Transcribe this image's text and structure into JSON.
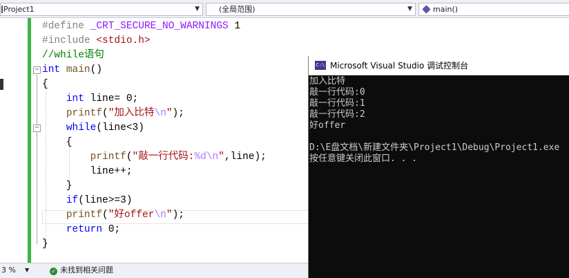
{
  "navbar": {
    "project": "Project1",
    "scope": "(全局范围)",
    "member": "main()"
  },
  "editor": {
    "lines": [
      {
        "parts": [
          [
            "pp",
            "#define "
          ],
          [
            "mac",
            "_CRT_SECURE_NO_WARNINGS"
          ],
          [
            "",
            " 1"
          ]
        ]
      },
      {
        "parts": [
          [
            "pp",
            "#include "
          ],
          [
            "str",
            "<stdio.h>"
          ]
        ]
      },
      {
        "parts": [
          [
            "cm",
            "//while语句"
          ]
        ]
      },
      {
        "parts": [
          [
            "k",
            "int"
          ],
          [
            "",
            " "
          ],
          [
            "fn",
            "main"
          ],
          [
            "",
            "()"
          ]
        ]
      },
      {
        "parts": [
          [
            "",
            "{"
          ]
        ]
      },
      {
        "parts": [
          [
            "",
            "    "
          ],
          [
            "k",
            "int"
          ],
          [
            "",
            " line= 0;"
          ]
        ]
      },
      {
        "parts": [
          [
            "",
            "    "
          ],
          [
            "fn",
            "printf"
          ],
          [
            "",
            "("
          ],
          [
            "str",
            "\"加入比特"
          ],
          [
            "esc",
            "\\n"
          ],
          [
            "str",
            "\""
          ],
          [
            "",
            ");"
          ]
        ]
      },
      {
        "parts": [
          [
            "",
            "    "
          ],
          [
            "k",
            "while"
          ],
          [
            "",
            "(line<3)"
          ]
        ]
      },
      {
        "parts": [
          [
            "",
            "    {"
          ]
        ]
      },
      {
        "parts": [
          [
            "",
            "        "
          ],
          [
            "fn",
            "printf"
          ],
          [
            "",
            "("
          ],
          [
            "str",
            "\"敲一行代码:"
          ],
          [
            "esc",
            "%d\\n"
          ],
          [
            "str",
            "\""
          ],
          [
            "",
            ",line);"
          ]
        ]
      },
      {
        "parts": [
          [
            "",
            "        line++;"
          ]
        ]
      },
      {
        "parts": [
          [
            "",
            "    }"
          ]
        ]
      },
      {
        "parts": [
          [
            "",
            "    "
          ],
          [
            "k",
            "if"
          ],
          [
            "",
            "(line>=3)"
          ]
        ]
      },
      {
        "parts": [
          [
            "",
            "    "
          ],
          [
            "fn",
            "printf"
          ],
          [
            "",
            "("
          ],
          [
            "str",
            "\"好offer"
          ],
          [
            "esc",
            "\\n"
          ],
          [
            "str",
            "\""
          ],
          [
            "",
            ");"
          ]
        ]
      },
      {
        "parts": [
          [
            "",
            "    "
          ],
          [
            "k",
            "return"
          ],
          [
            "",
            " 0;"
          ]
        ]
      },
      {
        "parts": [
          [
            "",
            "}"
          ]
        ]
      }
    ]
  },
  "statusbar": {
    "zoom": "3 %",
    "issues": "未找到相关问题"
  },
  "console": {
    "title": "Microsoft Visual Studio 调试控制台",
    "icon_label": "C:\\",
    "lines": [
      "加入比特",
      "敲一行代码:0",
      "敲一行代码:1",
      "敲一行代码:2",
      "好offer",
      "",
      "D:\\E盘文档\\新建文件夹\\Project1\\Debug\\Project1.exe",
      "按任意键关闭此窗口. . ."
    ]
  }
}
